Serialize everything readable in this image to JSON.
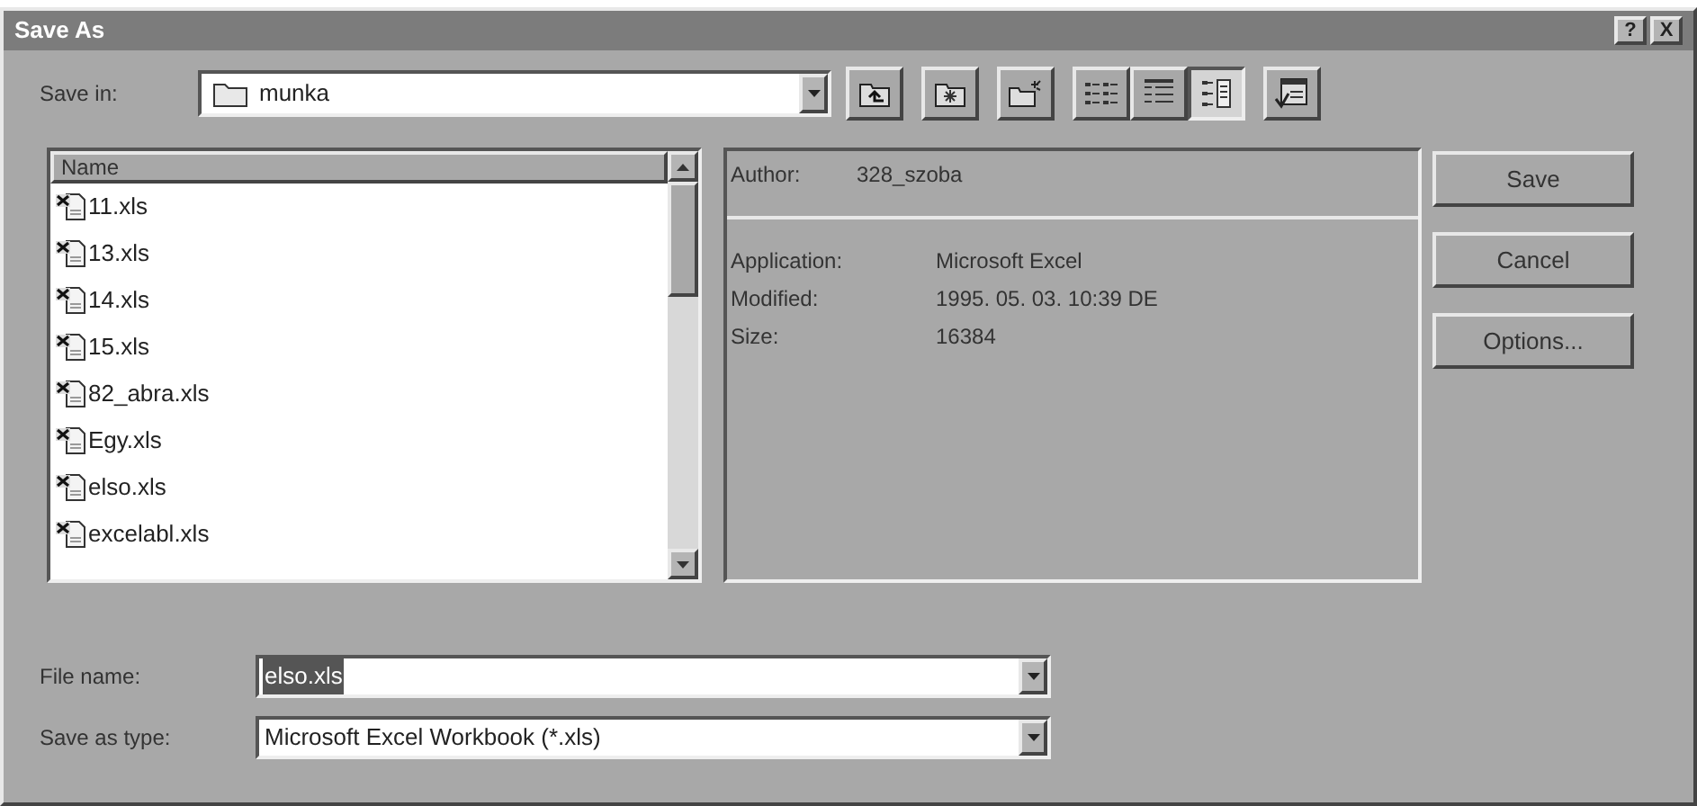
{
  "window": {
    "title": "Save As",
    "title_buttons": [
      "?",
      "X"
    ]
  },
  "save_in": {
    "label": "Save in:",
    "value": "munka"
  },
  "toolbar": [
    {
      "kind": "up-folder",
      "selected": false
    },
    {
      "kind": "favorites",
      "selected": false
    },
    {
      "kind": "new-folder",
      "selected": false
    },
    {
      "kind": "list-view",
      "selected": false
    },
    {
      "kind": "details-view",
      "selected": false
    },
    {
      "kind": "preview-view",
      "selected": true
    },
    {
      "kind": "commands",
      "selected": false
    }
  ],
  "file_list": {
    "column": "Name",
    "items": [
      {
        "name": "11.xls"
      },
      {
        "name": "13.xls"
      },
      {
        "name": "14.xls"
      },
      {
        "name": "15.xls"
      },
      {
        "name": "82_abra.xls"
      },
      {
        "name": "Egy.xls"
      },
      {
        "name": "elso.xls"
      },
      {
        "name": "excelabl.xls"
      }
    ]
  },
  "preview": {
    "author": {
      "label": "Author:",
      "value": "328_szoba"
    },
    "properties": [
      {
        "label": "Application:",
        "value": "Microsoft Excel"
      },
      {
        "label": "Modified:",
        "value": "1995. 05. 03. 10:39 DE"
      },
      {
        "label": "Size:",
        "value": "16384"
      }
    ]
  },
  "buttons": [
    "Save",
    "Cancel",
    "Options..."
  ],
  "file_name": {
    "label": "File name:",
    "value": "elso.xls",
    "text_selected": true
  },
  "save_as_type": {
    "label": "Save as type:",
    "value": "Microsoft Excel Workbook (*.xls)"
  }
}
